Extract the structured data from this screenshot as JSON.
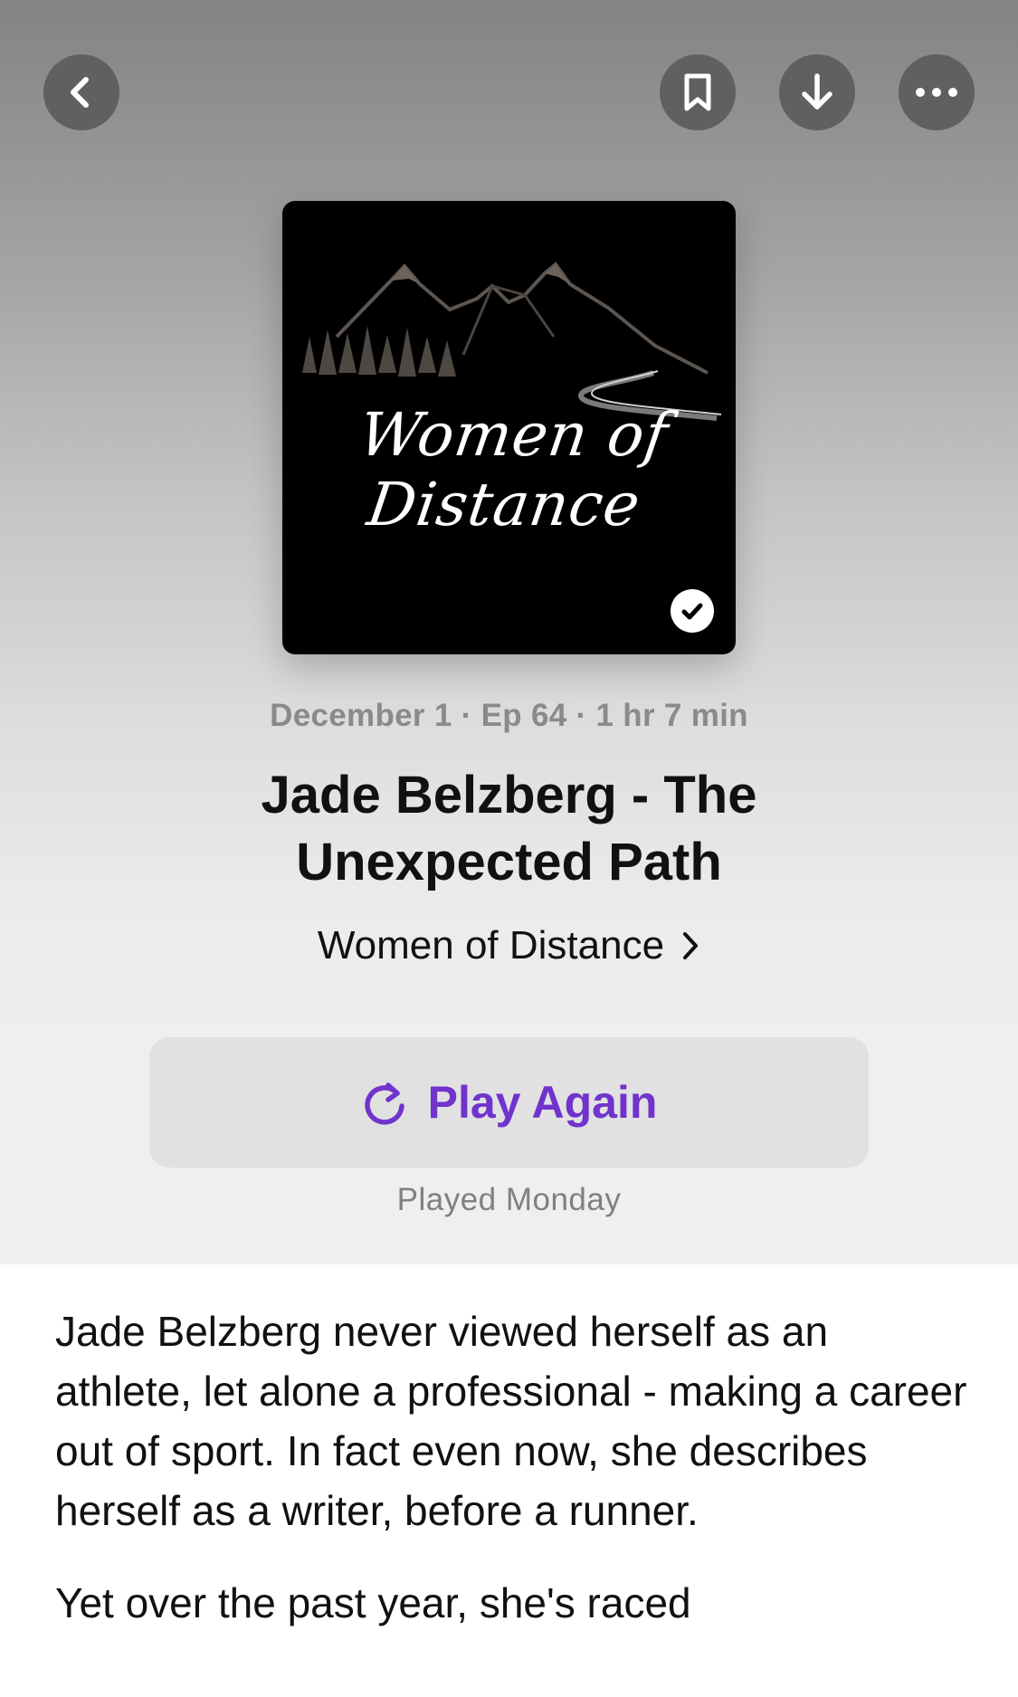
{
  "nav": {
    "back_icon": "chevron-left-icon",
    "bookmark_icon": "bookmark-icon",
    "download_icon": "arrow-down-icon",
    "more_icon": "ellipsis-icon"
  },
  "artwork": {
    "script_text": "Women of Distance",
    "played_badge_icon": "checkmark-icon"
  },
  "episode": {
    "meta": "December 1 · Ep 64 · 1 hr 7 min",
    "title": "Jade Belzberg - The Unexpected Path",
    "show_name": "Women of Distance"
  },
  "actions": {
    "play_label": "Play Again",
    "played_status": "Played Monday",
    "accent_color": "#7033cc"
  },
  "description": {
    "paragraphs": [
      "Jade Belzberg never viewed herself as an athlete, let alone a professional - making a career out of sport. In fact even now, she describes herself as a writer, before a runner.",
      "Yet over the past year, she's raced"
    ]
  }
}
